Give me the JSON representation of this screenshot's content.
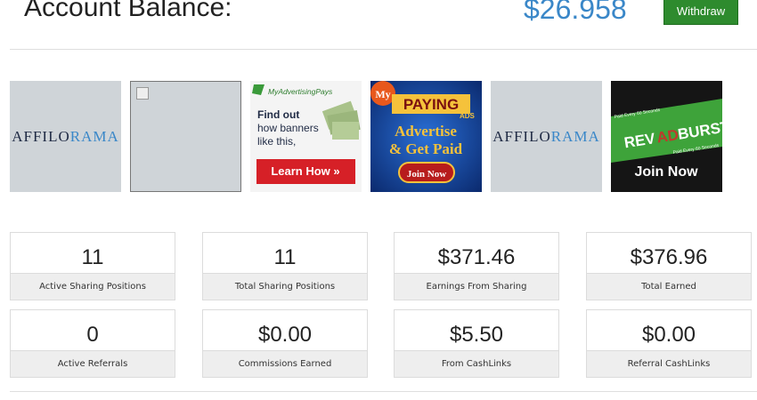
{
  "header": {
    "balance_label": "Account Balance:",
    "balance_value": "$26.958",
    "withdraw_label": "Withdraw"
  },
  "banners": [
    {
      "type": "affilorama",
      "text_a": "AFFILO",
      "text_b": "RAMA"
    },
    {
      "type": "broken-image"
    },
    {
      "type": "myadvertisingpays",
      "brand": "MyAdvertisingPays",
      "line1": "Find out",
      "line2": "how banners",
      "line3": "like this,",
      "cta": "Learn How »"
    },
    {
      "type": "mypayingads",
      "my": "My",
      "paying": "PAYING",
      "ads": "ADS",
      "advertise": "Advertise",
      "getpaid": "& Get Paid",
      "cta": "Join Now"
    },
    {
      "type": "affilorama",
      "text_a": "AFFILO",
      "text_b": "RAMA"
    },
    {
      "type": "revadburst",
      "paid_top": "Paid Every 60 Seconds",
      "rev": "REV",
      "ad": "AD",
      "burst": "BURST",
      "paid_bottom": "Paid Every 60 Seconds",
      "cta": "Join Now"
    }
  ],
  "stats": [
    {
      "value": "11",
      "label": "Active Sharing Positions"
    },
    {
      "value": "11",
      "label": "Total Sharing Positions"
    },
    {
      "value": "$371.46",
      "label": "Earnings From Sharing"
    },
    {
      "value": "$376.96",
      "label": "Total Earned"
    },
    {
      "value": "0",
      "label": "Active Referrals"
    },
    {
      "value": "$0.00",
      "label": "Commissions Earned"
    },
    {
      "value": "$5.50",
      "label": "From CashLinks"
    },
    {
      "value": "$0.00",
      "label": "Referral CashLinks"
    }
  ],
  "colors": {
    "balance": "#3a87c8",
    "withdraw_bg": "#2e8b2e",
    "banner_grey": "#cfd4d8"
  }
}
